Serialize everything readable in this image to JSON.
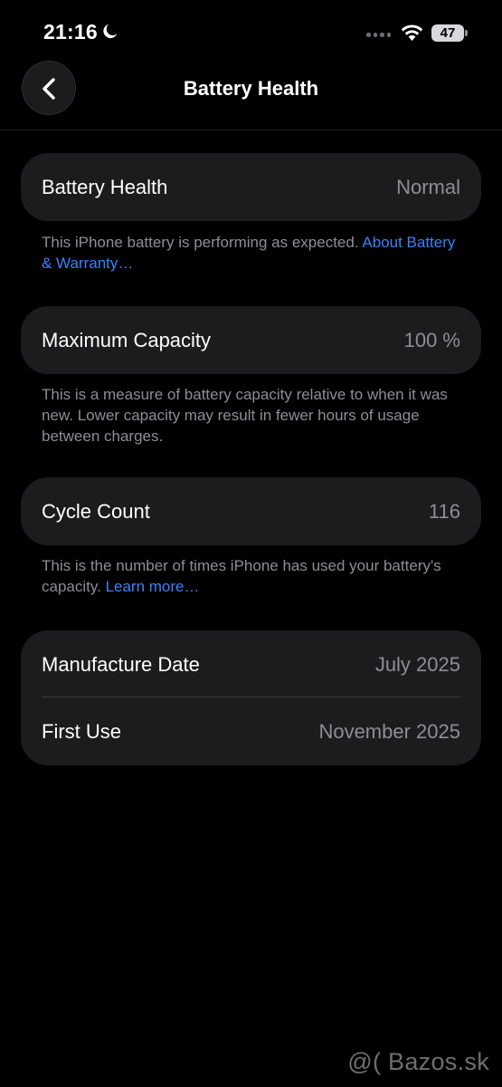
{
  "status_bar": {
    "time": "21:16",
    "battery_level": "47",
    "icons": [
      "moon-icon",
      "cellular-dots-icon",
      "wifi-icon",
      "battery-icon"
    ]
  },
  "nav": {
    "title": "Battery Health",
    "back_icon": "chevron-left-icon"
  },
  "battery_health": {
    "label": "Battery Health",
    "value": "Normal",
    "note": "This iPhone battery is performing as expected.",
    "link": "About Battery & Warranty…"
  },
  "maximum_capacity": {
    "label": "Maximum Capacity",
    "value": "100 %",
    "note": "This is a measure of battery capacity relative to when it was new. Lower capacity may result in fewer hours of usage between charges."
  },
  "cycle_count": {
    "label": "Cycle Count",
    "value": "116",
    "note": "This is the number of times iPhone has used your battery's capacity.",
    "link": "Learn more…"
  },
  "dates": {
    "manufacture_label": "Manufacture Date",
    "manufacture_value": "July 2025",
    "first_use_label": "First Use",
    "first_use_value": "November 2025"
  },
  "watermark": "@( Bazos.sk",
  "colors": {
    "background": "#000000",
    "card": "#1c1c1e",
    "secondary_text": "#8e8e93",
    "link": "#3a82f7"
  }
}
